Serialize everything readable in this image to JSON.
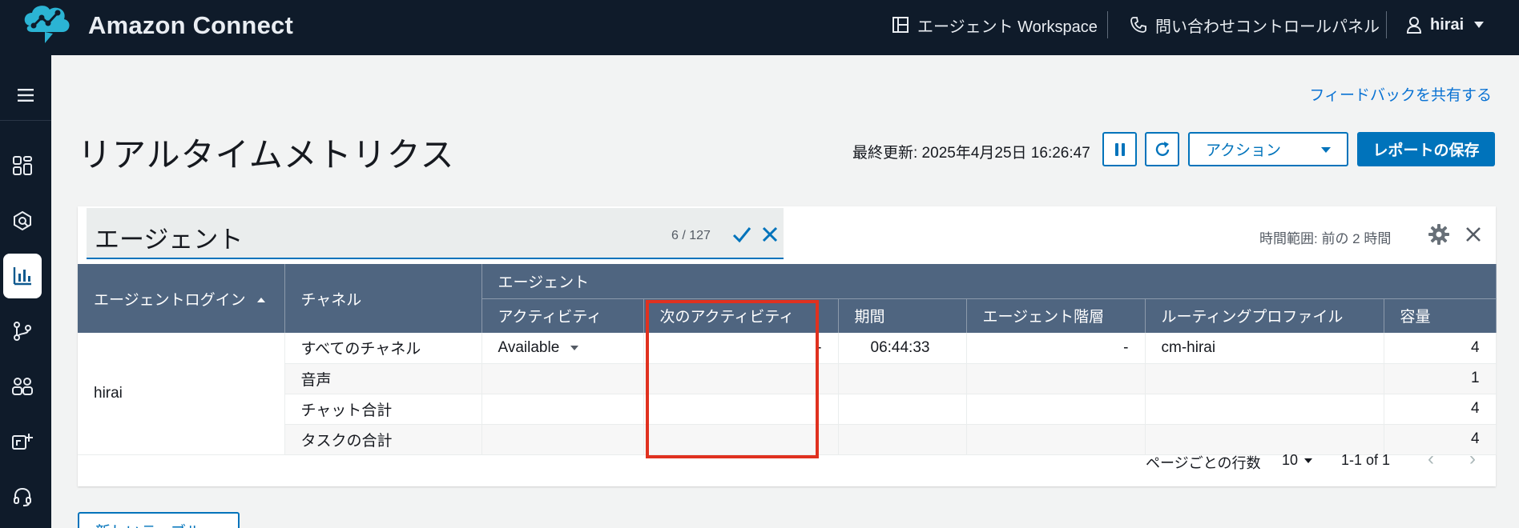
{
  "app": {
    "title": "Amazon Connect"
  },
  "topnav": {
    "workspace_label": "エージェント Workspace",
    "ccp_label": "問い合わせコントロールパネル",
    "user_name": "hirai"
  },
  "sidebar": {
    "items": [
      "menu-icon",
      "dashboard-icon",
      "analytics-icon",
      "metrics-icon",
      "routing-icon",
      "users-icon",
      "channels-icon",
      "headset-icon"
    ],
    "active": "metrics-icon"
  },
  "page": {
    "feedback_link": "フィードバックを共有する",
    "title": "リアルタイムメトリクス",
    "last_updated": "最終更新: 2025年4月25日 16:26:47",
    "action_label": "アクション",
    "save_report_label": "レポートの保存",
    "new_table_label": "新しいテーブル"
  },
  "table_card": {
    "name": "エージェント",
    "char_count": "6 / 127",
    "time_range": "時間範囲: 前の 2 時間",
    "headers": {
      "login": "エージェントログイン",
      "channel": "チャネル",
      "agent_group": "エージェント",
      "activity": "アクティビティ",
      "next_activity": "次のアクティビティ",
      "duration": "期間",
      "hierarchy": "エージェント階層",
      "routing_profile": "ルーティングプロファイル",
      "capacity": "容量"
    },
    "login_value": "hirai",
    "rows": [
      {
        "channel": "すべてのチャネル",
        "activity": "Available",
        "next_activity": "-",
        "duration": "06:44:33",
        "hierarchy": "-",
        "routing_profile": "cm-hirai",
        "capacity": "4"
      },
      {
        "channel": "音声",
        "activity": "",
        "next_activity": "",
        "duration": "",
        "hierarchy": "",
        "routing_profile": "",
        "capacity": "1"
      },
      {
        "channel": "チャット合計",
        "activity": "",
        "next_activity": "",
        "duration": "",
        "hierarchy": "",
        "routing_profile": "",
        "capacity": "4"
      },
      {
        "channel": "タスクの合計",
        "activity": "",
        "next_activity": "",
        "duration": "",
        "hierarchy": "",
        "routing_profile": "",
        "capacity": "4"
      }
    ],
    "pagination": {
      "rows_per_page_label": "ページごとの行数",
      "rows_per_page": "10",
      "range": "1-1 of 1",
      "prev": "‹",
      "next": "›"
    }
  },
  "colors": {
    "topbar": "#0f1b2a",
    "accent": "#0073bb",
    "table_header": "#4f6580",
    "highlight": "#e0311f"
  }
}
